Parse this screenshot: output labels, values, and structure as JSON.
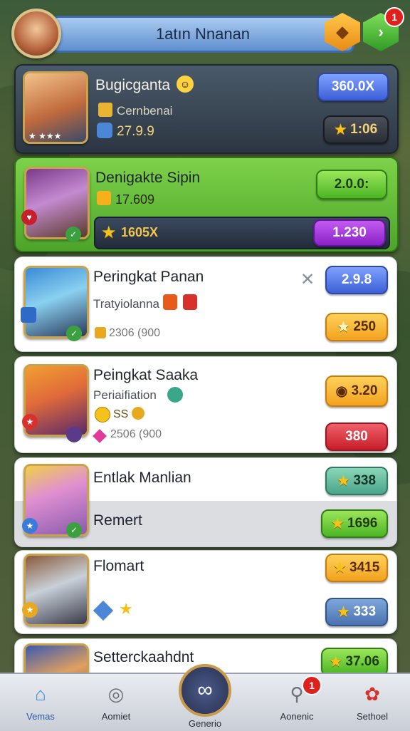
{
  "header": {
    "title": "1atın Nnanan",
    "badge_count": "1"
  },
  "cards": {
    "c1": {
      "name": "Bugicganta",
      "sub": "Cernbenai",
      "amount": "27.9.9",
      "primary": "360.0X",
      "secondary": "1:06"
    },
    "c2": {
      "name": "Denigakte Sipin",
      "amount": "17.609",
      "primary": "2.0.0:",
      "bar_value": "1605X",
      "bar_pill": "1.230"
    },
    "c3": {
      "name": "Peringkat Panan",
      "sub": "Tratyiolanna",
      "meta": "2306 (900",
      "primary": "2.9.8",
      "secondary": "250"
    },
    "c4": {
      "name": "Peingkat Saaka",
      "sub": "Periaifiation",
      "amount": "SS",
      "meta": "2506 (900",
      "primary": "3.20",
      "secondary": "380"
    },
    "c5": {
      "name": "Entlak Manlian",
      "row2": "Remert",
      "primary": "338",
      "secondary": "1696"
    },
    "c6": {
      "name": "Flomart",
      "primary": "3415",
      "secondary": "333"
    },
    "c7": {
      "name": "Setterckaahdnt",
      "primary": "37.06"
    }
  },
  "nav": {
    "items": [
      {
        "label": "Vemas"
      },
      {
        "label": "Aomiet"
      },
      {
        "label": "Generio"
      },
      {
        "label": "Aonenic"
      },
      {
        "label": "Sethoel"
      }
    ],
    "badge_count": "1"
  },
  "colors": {
    "accent": "#5f8fcf",
    "highlight_green": "#6cc63a",
    "gold": "#f2a21e"
  }
}
